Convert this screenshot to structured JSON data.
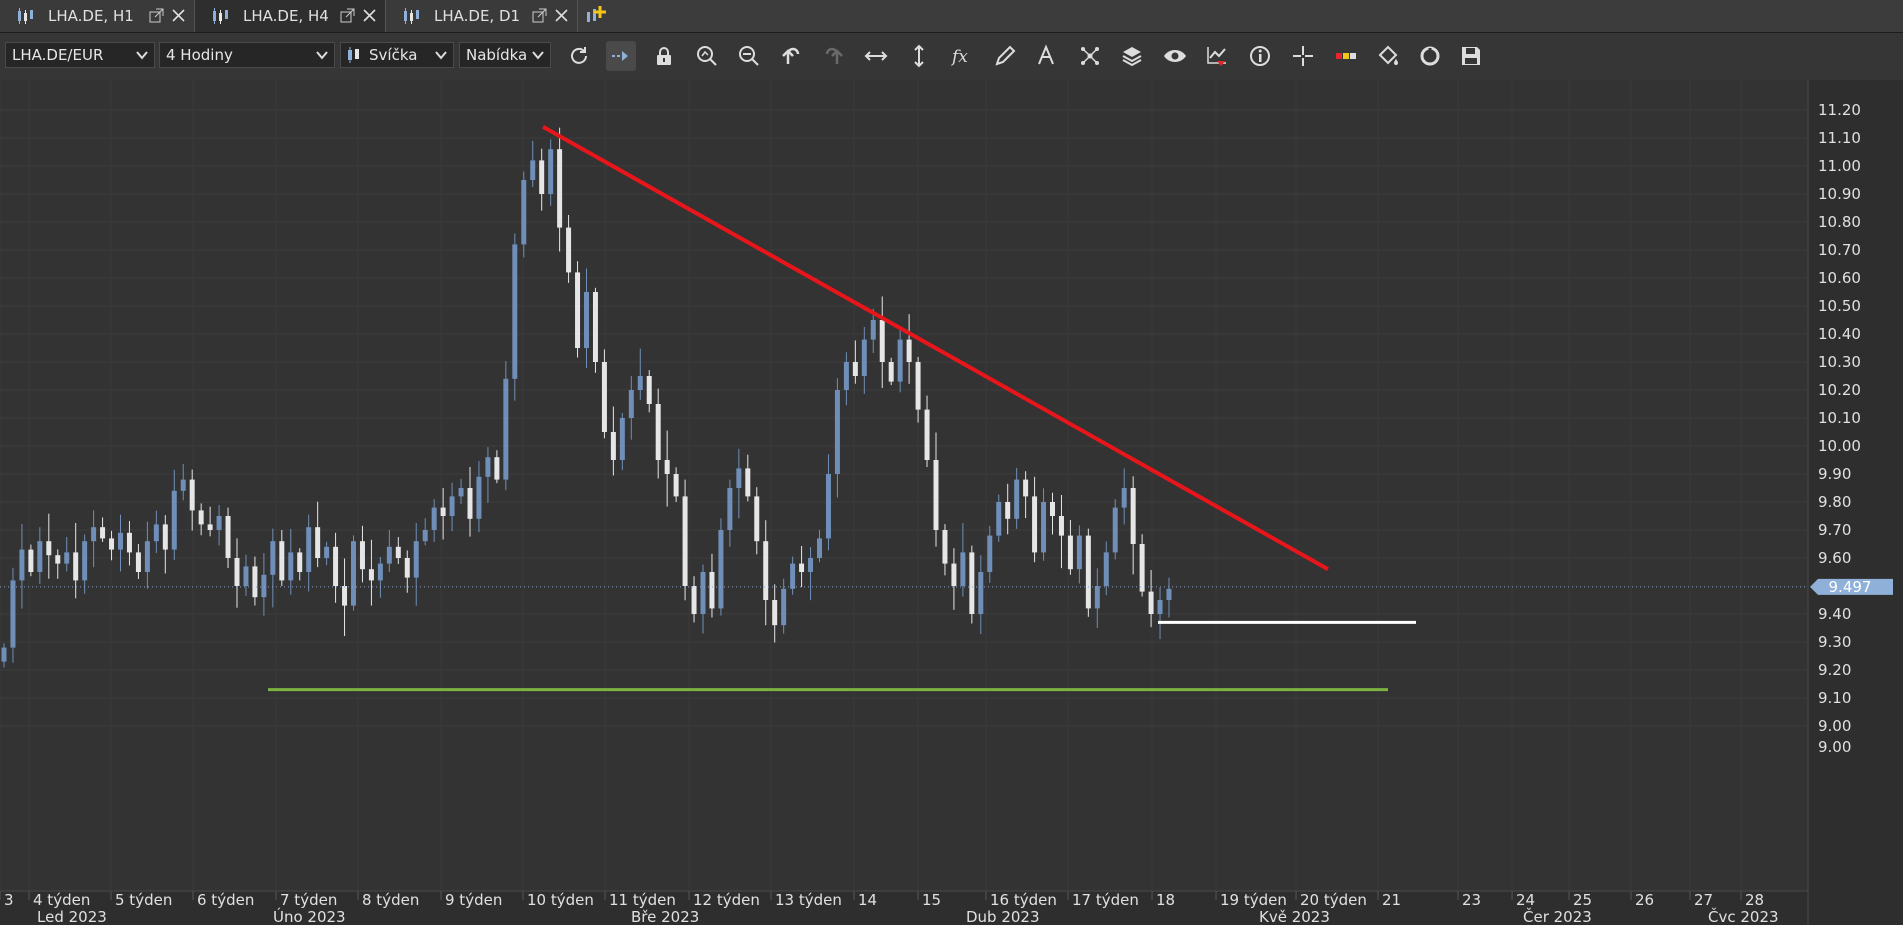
{
  "tabs": [
    {
      "label": "LHA.DE, H1",
      "active": false
    },
    {
      "label": "LHA.DE, H4",
      "active": true
    },
    {
      "label": "LHA.DE, D1",
      "active": false
    }
  ],
  "toolbar": {
    "instrument": "LHA.DE/EUR",
    "period": "4 Hodiny",
    "chart_type": "Svíčka",
    "price_side": "Nabídka",
    "icons": [
      "refresh-icon",
      "shift-chart-icon",
      "lock-icon",
      "zoom-in-icon",
      "zoom-out-icon",
      "undo-icon",
      "redo-icon",
      "fit-horizontal-icon",
      "fit-vertical-icon",
      "indicators-fx-icon",
      "pencil-draw-icon",
      "text-tool-icon",
      "patterns-icon",
      "layers-icon",
      "visibility-eye-icon",
      "alert-icon",
      "info-icon",
      "crosshair-icon",
      "color-themes-icon",
      "paint-bucket-icon",
      "cycle-icon",
      "save-icon"
    ]
  },
  "chart_data": {
    "type": "candlestick",
    "symbol": "LHA.DE/EUR",
    "timeframe": "4 Hodiny",
    "ylim": [
      9.0,
      11.2
    ],
    "price_axis_labels": [
      "11.20",
      "11.10",
      "11.00",
      "10.90",
      "10.80",
      "10.70",
      "10.60",
      "10.50",
      "10.40",
      "10.30",
      "10.20",
      "10.10",
      "10.00",
      "9.90",
      "9.80",
      "9.70",
      "9.60",
      "9.40",
      "9.30",
      "9.20",
      "9.10",
      "9.00",
      "9.00"
    ],
    "current_price": {
      "label": "9.497",
      "value": 9.497
    },
    "week_labels": [
      "3",
      "4 týden",
      "5 týden",
      "6 týden",
      "7 týden",
      "8 týden",
      "9 týden",
      "10 týden",
      "11 týden",
      "12 týden",
      "13 týden",
      "14",
      "15",
      "16 týden",
      "17 týden",
      "18",
      "19 týden",
      "20 týden",
      "21",
      "23",
      "24",
      "25",
      "26",
      "27",
      "28"
    ],
    "month_labels": [
      "Led 2023",
      "Úno 2023",
      "Bře 2023",
      "Dub 2023",
      "Kvě 2023",
      "Čer 2023",
      "Čvc 2023"
    ],
    "trend_lines": [
      {
        "name": "descending resistance",
        "color": "#e8161b",
        "start_price": 11.14,
        "end_price": 9.56
      },
      {
        "name": "support",
        "color": "#7cb342",
        "price": 9.13
      },
      {
        "name": "horizontal level",
        "color": "#ffffff",
        "price": 9.37
      }
    ],
    "bull_color": "#6f8fb8",
    "bear_color": "#e6e6e6",
    "closes": [
      9.28,
      9.52,
      9.63,
      9.55,
      9.66,
      9.61,
      9.58,
      9.62,
      9.52,
      9.66,
      9.71,
      9.67,
      9.63,
      9.69,
      9.62,
      9.55,
      9.66,
      9.72,
      9.63,
      9.84,
      9.88,
      9.77,
      9.72,
      9.7,
      9.75,
      9.6,
      9.5,
      9.57,
      9.46,
      9.54,
      9.66,
      9.52,
      9.62,
      9.55,
      9.71,
      9.6,
      9.64,
      9.5,
      9.43,
      9.66,
      9.56,
      9.52,
      9.58,
      9.64,
      9.6,
      9.53,
      9.66,
      9.7,
      9.78,
      9.75,
      9.82,
      9.85,
      9.74,
      9.89,
      9.96,
      9.88,
      10.24,
      10.72,
      10.95,
      11.02,
      10.9,
      11.06,
      10.78,
      10.62,
      10.35,
      10.55,
      10.3,
      10.05,
      9.95,
      10.1,
      10.2,
      10.25,
      10.15,
      9.95,
      9.9,
      9.82,
      9.5,
      9.4,
      9.55,
      9.42,
      9.7,
      9.85,
      9.92,
      9.82,
      9.66,
      9.45,
      9.36,
      9.49,
      9.58,
      9.55,
      9.6,
      9.67,
      9.9,
      10.2,
      10.3,
      10.25,
      10.38,
      10.45,
      10.3,
      10.23,
      10.38,
      10.3,
      10.13,
      9.95,
      9.7,
      9.58,
      9.5,
      9.62,
      9.4,
      9.55,
      9.68,
      9.8,
      9.74,
      9.88,
      9.82,
      9.62,
      9.8,
      9.75,
      9.68,
      9.56,
      9.68,
      9.42,
      9.5,
      9.62,
      9.78,
      9.85,
      9.65,
      9.48,
      9.4,
      9.45,
      9.49
    ]
  }
}
